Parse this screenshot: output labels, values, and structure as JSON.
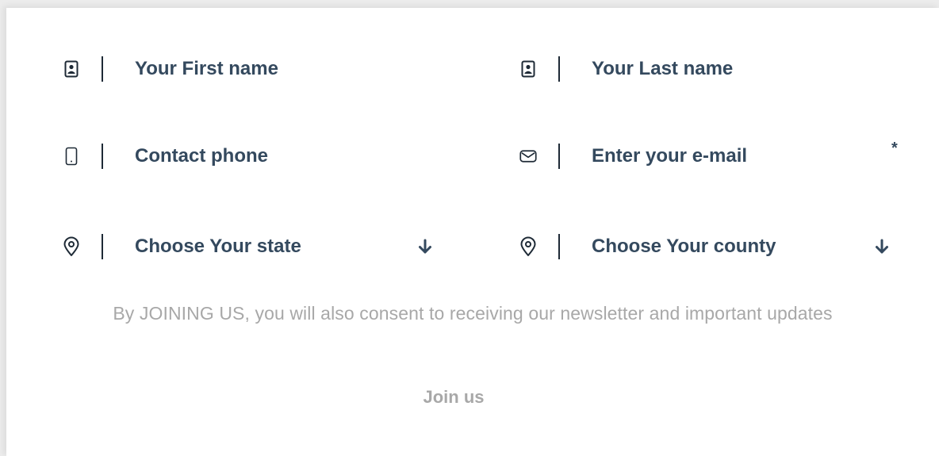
{
  "form": {
    "first_name": {
      "placeholder": "Your First name",
      "icon": "contact-card-icon"
    },
    "last_name": {
      "placeholder": "Your Last name",
      "icon": "contact-card-icon"
    },
    "phone": {
      "placeholder": "Contact phone",
      "icon": "phone-icon"
    },
    "email": {
      "placeholder": "Enter your e-mail",
      "icon": "envelope-icon",
      "required_mark": "*"
    },
    "state": {
      "placeholder": "Choose Your state",
      "icon": "location-pin-icon",
      "arrow_icon": "arrow-down-icon"
    },
    "county": {
      "placeholder": "Choose Your county",
      "icon": "location-pin-icon",
      "arrow_icon": "arrow-down-icon"
    },
    "consent_text": "By JOINING US, you will also consent to receiving our newsletter and important updates",
    "submit_label": "Join us"
  },
  "colors": {
    "text_dark": "#34495e",
    "divider": "#1e2a36",
    "muted": "#a8a8a8",
    "background": "#ffffff"
  }
}
